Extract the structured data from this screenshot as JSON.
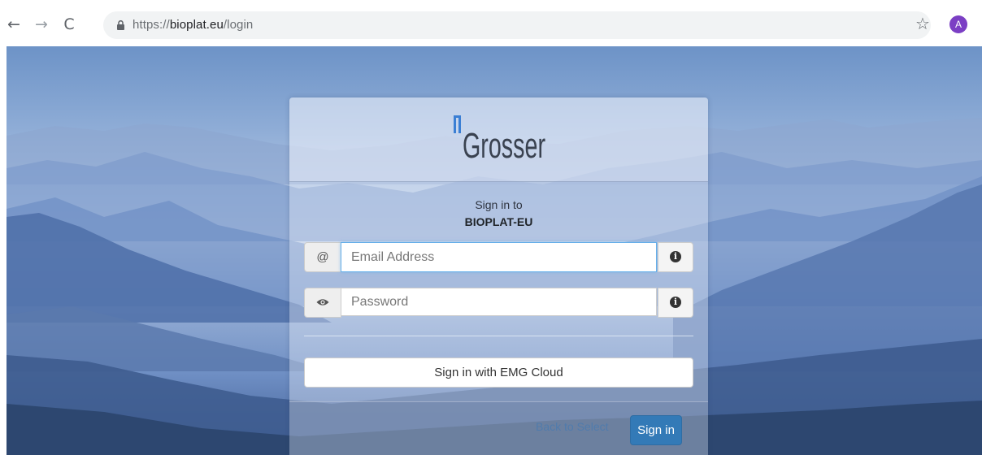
{
  "browser": {
    "back_glyph": "←",
    "forward_glyph": "→",
    "reload_glyph": "C",
    "url_scheme": "https://",
    "url_host": "bioplat.eu",
    "url_path": "/login",
    "star_glyph": "☆",
    "avatar_initial": "A",
    "avatar_color": "#7b3fc4"
  },
  "login": {
    "logo_text": "Grosser",
    "logo_accent_color": "#3b7fd4",
    "signin_to": "Sign in to",
    "tenant_name": "BIOPLAT-EU",
    "email": {
      "addon_glyph": "@",
      "placeholder": "Email Address",
      "value": "",
      "info_glyph": "i"
    },
    "password": {
      "addon_icon": "eye-icon",
      "placeholder": "Password",
      "value": "",
      "info_glyph": "i"
    },
    "emg_button_label": "Sign in with EMG Cloud",
    "back_link_label": "Back to Select",
    "signin_button_label": "Sign in",
    "primary_color": "#337ab7"
  }
}
